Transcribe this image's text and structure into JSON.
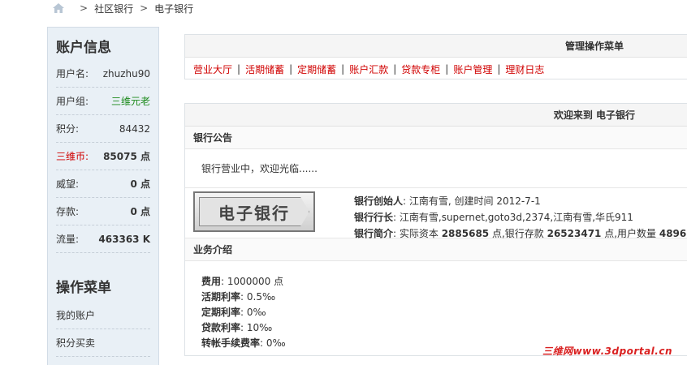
{
  "breadcrumb": {
    "items": [
      "社区银行",
      "电子银行"
    ],
    "separator": ">"
  },
  "sidebar": {
    "title": "账户信息",
    "info": [
      {
        "label": "用户名:",
        "value": "zhuzhu90"
      },
      {
        "label": "用户组:",
        "value": "三维元老"
      },
      {
        "label": "积分:",
        "value": "84432"
      },
      {
        "label": "三维币:",
        "value": "85075 点"
      },
      {
        "label": "威望:",
        "value": "0 点"
      },
      {
        "label": "存款:",
        "value": "0 点"
      },
      {
        "label": "流量:",
        "value": "463363 K"
      }
    ],
    "menu_title": "操作菜单",
    "menu": [
      "我的账户",
      "积分买卖"
    ]
  },
  "manage": {
    "title": "管理操作菜单",
    "links": [
      "营业大厅",
      "活期储蓄",
      "定期储蓄",
      "账户汇款",
      "贷款专柜",
      "账户管理",
      "理财日志"
    ]
  },
  "welcome": {
    "title": "欢迎来到 电子银行",
    "notice_head": "银行公告",
    "notice_text": "银行营业中，欢迎光临......",
    "logo_text": "电子银行",
    "founder_label": "银行创始人",
    "founder_value": ": 江南有雪, 创建时间 2012-7-1",
    "president_label": "银行行长",
    "president_value": ": 江南有雪,supernet,goto3d,2374,江南有雪,华氏911",
    "intro_label": "银行简介",
    "intro_prefix": ": 实际资本 ",
    "capital": "2885685",
    "intro_mid": " 点,银行存款 ",
    "deposits": "26523471",
    "intro_mid2": " 点,用户数量 ",
    "users": "4896",
    "service_head": "业务介绍",
    "services": [
      {
        "label": "费用",
        "value": ": 1000000 点"
      },
      {
        "label": "活期利率",
        "value": ": 0.5‰"
      },
      {
        "label": "定期利率",
        "value": ": 0‰"
      },
      {
        "label": "贷款利率",
        "value": ": 10‰"
      },
      {
        "label": "转帐手续费率",
        "value": ": 0‰"
      }
    ]
  },
  "watermark": "三维网www.3dportal.cn",
  "colors": {
    "accent_red": "#d00000",
    "sidebar_bg": "#e9f0f6",
    "green": "#1c8a1c"
  }
}
